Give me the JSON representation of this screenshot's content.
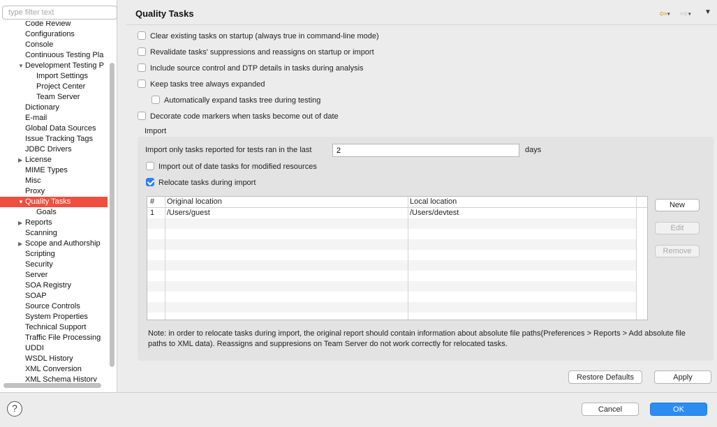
{
  "filter": {
    "placeholder": "type filter text"
  },
  "tree": [
    {
      "label": "Code Review",
      "level": 1,
      "expander": "none",
      "selected": false
    },
    {
      "label": "Configurations",
      "level": 1,
      "expander": "none",
      "selected": false
    },
    {
      "label": "Console",
      "level": 1,
      "expander": "none",
      "selected": false
    },
    {
      "label": "Continuous Testing Pla",
      "level": 1,
      "expander": "none",
      "selected": false
    },
    {
      "label": "Development Testing P",
      "level": 1,
      "expander": "expanded",
      "selected": false
    },
    {
      "label": "Import Settings",
      "level": 2,
      "expander": "none",
      "selected": false
    },
    {
      "label": "Project Center",
      "level": 2,
      "expander": "none",
      "selected": false
    },
    {
      "label": "Team Server",
      "level": 2,
      "expander": "none",
      "selected": false
    },
    {
      "label": "Dictionary",
      "level": 1,
      "expander": "none",
      "selected": false
    },
    {
      "label": "E-mail",
      "level": 1,
      "expander": "none",
      "selected": false
    },
    {
      "label": "Global Data Sources",
      "level": 1,
      "expander": "none",
      "selected": false
    },
    {
      "label": "Issue Tracking Tags",
      "level": 1,
      "expander": "none",
      "selected": false
    },
    {
      "label": "JDBC Drivers",
      "level": 1,
      "expander": "none",
      "selected": false
    },
    {
      "label": "License",
      "level": 1,
      "expander": "collapsed",
      "selected": false
    },
    {
      "label": "MIME Types",
      "level": 1,
      "expander": "none",
      "selected": false
    },
    {
      "label": "Misc",
      "level": 1,
      "expander": "none",
      "selected": false
    },
    {
      "label": "Proxy",
      "level": 1,
      "expander": "none",
      "selected": false
    },
    {
      "label": "Quality Tasks",
      "level": 1,
      "expander": "expanded",
      "selected": true
    },
    {
      "label": "Goals",
      "level": 2,
      "expander": "none",
      "selected": false
    },
    {
      "label": "Reports",
      "level": 1,
      "expander": "collapsed",
      "selected": false
    },
    {
      "label": "Scanning",
      "level": 1,
      "expander": "none",
      "selected": false
    },
    {
      "label": "Scope and Authorship",
      "level": 1,
      "expander": "collapsed",
      "selected": false
    },
    {
      "label": "Scripting",
      "level": 1,
      "expander": "none",
      "selected": false
    },
    {
      "label": "Security",
      "level": 1,
      "expander": "none",
      "selected": false
    },
    {
      "label": "Server",
      "level": 1,
      "expander": "none",
      "selected": false
    },
    {
      "label": "SOA Registry",
      "level": 1,
      "expander": "none",
      "selected": false
    },
    {
      "label": "SOAP",
      "level": 1,
      "expander": "none",
      "selected": false
    },
    {
      "label": "Source Controls",
      "level": 1,
      "expander": "none",
      "selected": false
    },
    {
      "label": "System Properties",
      "level": 1,
      "expander": "none",
      "selected": false
    },
    {
      "label": "Technical Support",
      "level": 1,
      "expander": "none",
      "selected": false
    },
    {
      "label": "Traffic File Processing",
      "level": 1,
      "expander": "none",
      "selected": false
    },
    {
      "label": "UDDI",
      "level": 1,
      "expander": "none",
      "selected": false
    },
    {
      "label": "WSDL History",
      "level": 1,
      "expander": "none",
      "selected": false
    },
    {
      "label": "XML Conversion",
      "level": 1,
      "expander": "none",
      "selected": false
    },
    {
      "label": "XML Schema History",
      "level": 1,
      "expander": "none",
      "selected": false
    }
  ],
  "header": {
    "title": "Quality Tasks",
    "back_icon": "back-arrow-icon",
    "forward_icon": "forward-arrow-icon",
    "menu_icon": "view-menu-icon"
  },
  "options": {
    "clear_tasks": {
      "label": "Clear existing tasks on startup (always true in command-line mode)",
      "checked": false
    },
    "revalidate": {
      "label": "Revalidate tasks' suppressions and reassigns on startup or import",
      "checked": false
    },
    "include_scm": {
      "label": "Include source control and DTP details in tasks during analysis",
      "checked": false
    },
    "keep_expanded": {
      "label": "Keep tasks tree always expanded",
      "checked": false
    },
    "auto_expand": {
      "label": "Automatically expand tasks tree during testing",
      "checked": false
    },
    "decorate_markers": {
      "label": "Decorate code markers when tasks become out of date",
      "checked": false
    }
  },
  "import": {
    "group_label": "Import",
    "days_label": "Import only tasks reported for tests ran in the last",
    "days_value": "2",
    "days_unit": "days",
    "out_of_date": {
      "label": "Import out of date tasks for modified resources",
      "checked": false
    },
    "relocate": {
      "label": "Relocate tasks during import",
      "checked": true
    },
    "table": {
      "headers": [
        "#",
        "Original location",
        "Local location"
      ],
      "rows": [
        [
          "1",
          "/Users/guest",
          "/Users/devtest"
        ]
      ]
    },
    "buttons": {
      "new": "New",
      "edit": "Edit",
      "remove": "Remove"
    },
    "note": "Note: in order to relocate tasks during import, the original report should contain information about absolute file paths(Preferences > Reports > Add absolute file paths to XML data). Reassigns and suppresions on Team Server do not work correctly for relocated tasks."
  },
  "actions": {
    "restore_defaults": "Restore Defaults",
    "apply": "Apply",
    "cancel": "Cancel",
    "ok": "OK"
  },
  "footer": {
    "help_icon": "help-icon",
    "help_glyph": "?"
  },
  "colors": {
    "selection": "#f04e3e",
    "checkbox_checked": "#2d7ef3",
    "primary_button": "#2d8cf0"
  }
}
